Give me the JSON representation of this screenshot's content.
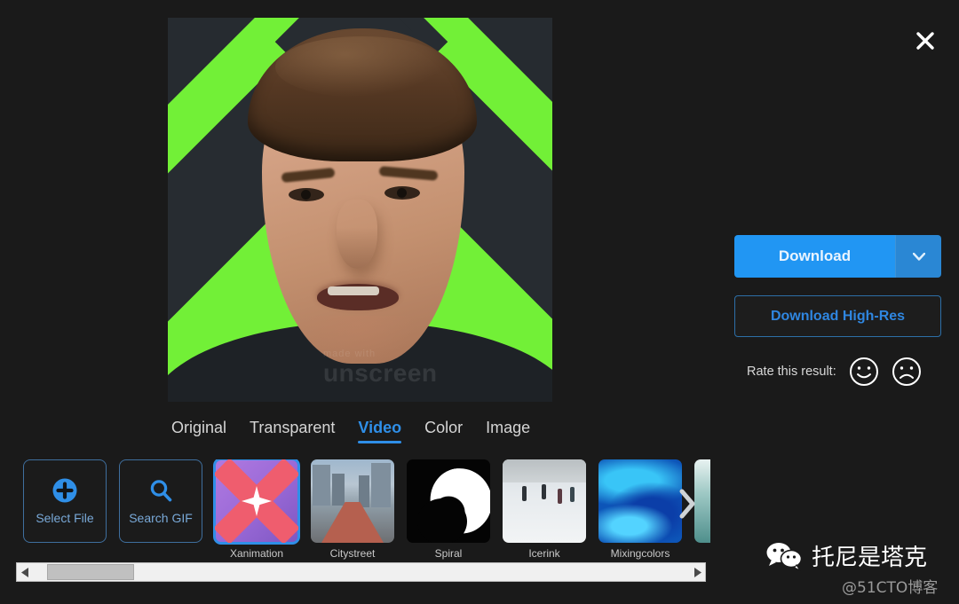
{
  "window": {
    "background_color": "#1a1a1a",
    "close_label": "✕"
  },
  "preview": {
    "alt_description": "Elon Musk portrait on green and yellow X background",
    "watermark_made_with": "made with",
    "watermark_brand": "unscreen"
  },
  "actions": {
    "download_label": "Download",
    "download_caret": "▾",
    "download_highres_label": "Download High-Res",
    "accent_color": "#2196f3",
    "link_color": "#2f86e0"
  },
  "rating": {
    "label": "Rate this result:",
    "positive_icon": "smiley-face-icon",
    "negative_icon": "frowny-face-icon"
  },
  "tabs": [
    {
      "label": "Original",
      "active": false
    },
    {
      "label": "Transparent",
      "active": false
    },
    {
      "label": "Video",
      "active": true
    },
    {
      "label": "Color",
      "active": false
    },
    {
      "label": "Image",
      "active": false
    }
  ],
  "strip": {
    "select_file_label": "Select File",
    "select_file_icon": "plus-circle-icon",
    "search_gif_label": "Search GIF",
    "search_gif_icon": "search-icon",
    "next_icon": "chevron-right-icon",
    "thumbnails": [
      {
        "label": "Xanimation",
        "art": "t-xanim",
        "selected": true
      },
      {
        "label": "Citystreet",
        "art": "t-city",
        "selected": false
      },
      {
        "label": "Spiral",
        "art": "t-spiral",
        "selected": false
      },
      {
        "label": "Icerink",
        "art": "t-ice",
        "selected": false
      },
      {
        "label": "Mixingcolors",
        "art": "t-mix",
        "selected": false
      },
      {
        "label": "",
        "art": "t-teal",
        "selected": false
      }
    ]
  },
  "scrollbar": {
    "left_arrow": "◀",
    "right_arrow": "▶"
  },
  "watermark": {
    "icon": "wechat-icon",
    "name": "托尼是塔克",
    "handle": "@51CTO博客"
  }
}
